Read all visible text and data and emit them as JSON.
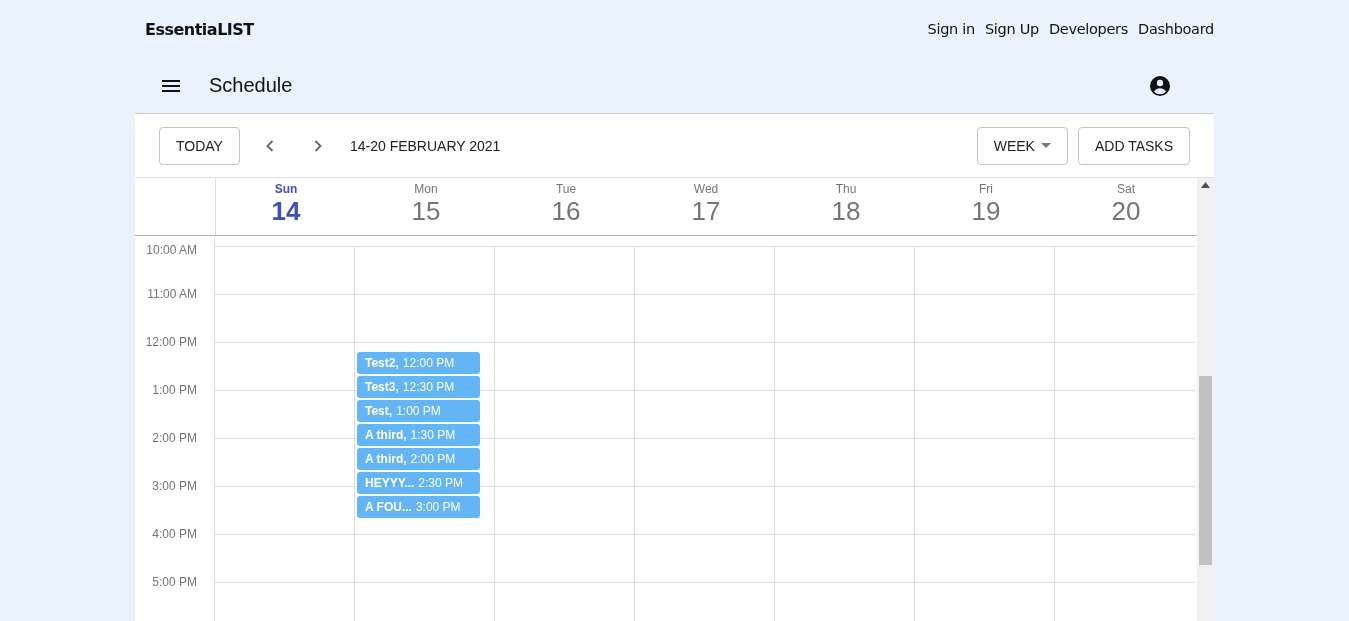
{
  "brand": "EssentiaLIST",
  "nav_links": [
    "Sign in",
    "Sign Up",
    "Developers",
    "Dashboard"
  ],
  "app_bar": {
    "title": "Schedule"
  },
  "toolbar": {
    "today_button": "TODAY",
    "date_range": "14-20 FEBRUARY 2021",
    "view_select": "WEEK",
    "add_button": "ADD TASKS"
  },
  "days": [
    {
      "weekday": "Sun",
      "date": "14",
      "selected": true
    },
    {
      "weekday": "Mon",
      "date": "15",
      "selected": false,
      "events": [
        {
          "title": "Test2,",
          "time": "12:00 PM"
        },
        {
          "title": "Test3,",
          "time": "12:30 PM"
        },
        {
          "title": "Test,",
          "time": "1:00 PM"
        },
        {
          "title": "A third,",
          "time": "1:30 PM"
        },
        {
          "title": "A third,",
          "time": "2:00 PM"
        },
        {
          "title": "HEYYY...",
          "time": "2:30 PM"
        },
        {
          "title": "A FOU...",
          "time": "3:00 PM"
        }
      ]
    },
    {
      "weekday": "Tue",
      "date": "16",
      "selected": false
    },
    {
      "weekday": "Wed",
      "date": "17",
      "selected": false
    },
    {
      "weekday": "Thu",
      "date": "18",
      "selected": false
    },
    {
      "weekday": "Fri",
      "date": "19",
      "selected": false
    },
    {
      "weekday": "Sat",
      "date": "20",
      "selected": false
    }
  ],
  "time_labels": [
    "10:00 AM",
    "11:00 AM",
    "12:00 PM",
    "1:00 PM",
    "2:00 PM",
    "3:00 PM",
    "4:00 PM",
    "5:00 PM"
  ]
}
